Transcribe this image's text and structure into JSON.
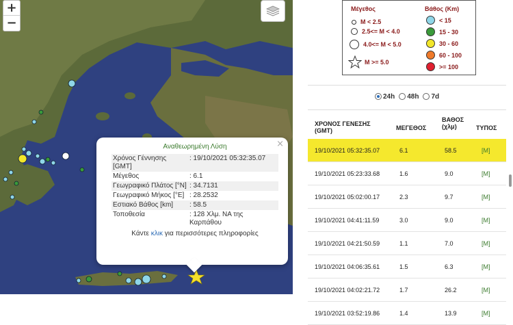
{
  "map": {
    "zoom_in": "+",
    "zoom_out": "−",
    "layers_icon": "layers-icon",
    "colors": {
      "sea": "#2e3f7a",
      "land": "#5b6b3a"
    }
  },
  "popup": {
    "title": "Αναθεωρημένη Λύση",
    "close": "×",
    "rows": [
      {
        "key": "Χρόνος Γέννησης [GMT]",
        "val": ": 19/10/2021 05:32:35.07"
      },
      {
        "key": "Μέγεθος",
        "val": ": 6.1"
      },
      {
        "key": "Γεωγραφικό Πλάτος [°N]",
        "val": ": 34.7131"
      },
      {
        "key": "Γεωγραφικό Μήκος [°E]",
        "val": ": 28.2532"
      },
      {
        "key": "Εστιακό Βάθος [km]",
        "val": ": 58.5"
      },
      {
        "key": "Τοποθεσία",
        "val": ": 128 Χλμ. ΝΑ της Καρπάθου"
      }
    ],
    "footer_pre": "Κάντε ",
    "footer_link": "κλικ",
    "footer_post": " για περισσότερες πληροφορίες"
  },
  "legend": {
    "magnitude_header": "Μέγεθος",
    "depth_header": "Βάθος (Km)",
    "magnitudes": [
      "M < 2.5",
      "2.5<= M < 4.0",
      "4.0<= M < 5.0",
      "M >= 5.0"
    ],
    "depths": [
      {
        "label": "< 15",
        "color": "#8fd6e8"
      },
      {
        "label": "15 - 30",
        "color": "#3a9a3a"
      },
      {
        "label": "30 - 60",
        "color": "#f2e62a"
      },
      {
        "label": "60 - 100",
        "color": "#ef7a2a"
      },
      {
        "label": ">= 100",
        "color": "#e02030"
      }
    ]
  },
  "filters": {
    "options": [
      "24h",
      "48h",
      "7d"
    ],
    "selected": "24h"
  },
  "table": {
    "headers": {
      "time": "ΧΡΟΝΟΣ ΓΕΝΕΣΗΣ (GMT)",
      "mag": "ΜΕΓΕΘΟΣ",
      "depth": "ΒΑΘΟΣ (χλμ)",
      "type": "ΤΥΠΟΣ"
    },
    "rows": [
      {
        "time": "19/10/2021 05:32:35.07",
        "mag": "6.1",
        "depth": "58.5",
        "type": "[M]",
        "highlight": true
      },
      {
        "time": "19/10/2021 05:23:33.68",
        "mag": "1.6",
        "depth": "9.0",
        "type": "[M]"
      },
      {
        "time": "19/10/2021 05:02:00.17",
        "mag": "2.3",
        "depth": "9.7",
        "type": "[M]"
      },
      {
        "time": "19/10/2021 04:41:11.59",
        "mag": "3.0",
        "depth": "9.0",
        "type": "[M]"
      },
      {
        "time": "19/10/2021 04:21:50.59",
        "mag": "1.1",
        "depth": "7.0",
        "type": "[M]"
      },
      {
        "time": "19/10/2021 04:06:35.61",
        "mag": "1.5",
        "depth": "6.3",
        "type": "[M]"
      },
      {
        "time": "19/10/2021 04:02:21.72",
        "mag": "1.7",
        "depth": "26.2",
        "type": "[M]"
      },
      {
        "time": "19/10/2021 03:52:19.86",
        "mag": "1.4",
        "depth": "13.9",
        "type": "[M]"
      }
    ]
  }
}
